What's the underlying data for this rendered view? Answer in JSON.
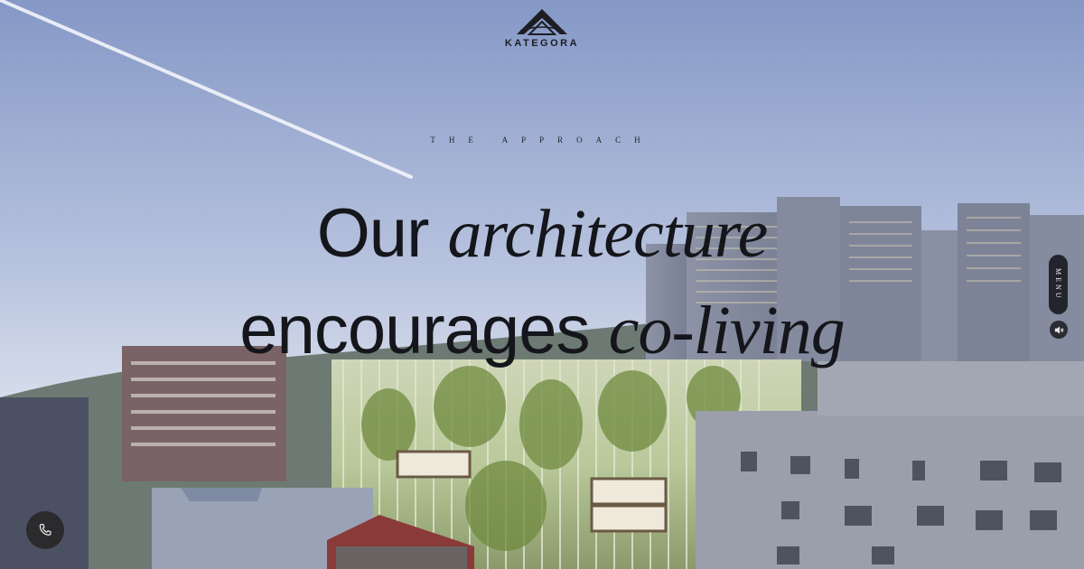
{
  "brand": {
    "logo_text": "KATEGORA"
  },
  "section": {
    "eyebrow": "THE APPROACH"
  },
  "hero": {
    "line1_plain": "Our",
    "line1_italic": "architecture",
    "line2_plain": "encourages",
    "line2_italic": "co-living"
  },
  "nav": {
    "menu_label": "MENU"
  },
  "controls": {
    "mute_icon": "speaker-muted-icon",
    "phone_icon": "phone-icon"
  },
  "colors": {
    "sky_top": "#8fa3cf",
    "sky_bottom": "#cdd6e8",
    "text_dark": "#15161b",
    "pill_dark": "#23252c"
  }
}
